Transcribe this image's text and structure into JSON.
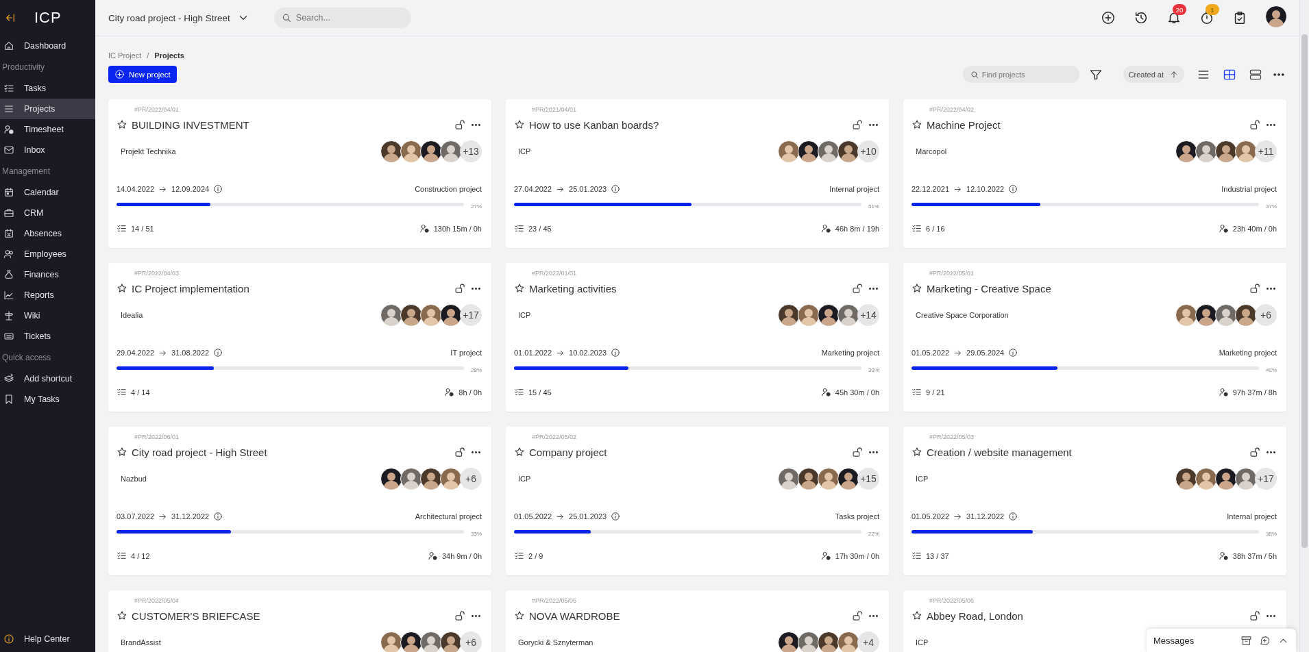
{
  "sidebar": {
    "logo": "ICP",
    "top_items": [
      {
        "label": "Dashboard",
        "selected": false
      }
    ],
    "sections": [
      {
        "title": "Productivity",
        "items": [
          {
            "label": "Tasks",
            "selected": false
          },
          {
            "label": "Projects",
            "selected": true
          },
          {
            "label": "Timesheet",
            "selected": false
          },
          {
            "label": "Inbox",
            "selected": false
          }
        ]
      },
      {
        "title": "Management",
        "items": [
          {
            "label": "Calendar",
            "selected": false
          },
          {
            "label": "CRM",
            "selected": false
          },
          {
            "label": "Absences",
            "selected": false
          },
          {
            "label": "Employees",
            "selected": false
          },
          {
            "label": "Finances",
            "selected": false
          },
          {
            "label": "Reports",
            "selected": false
          },
          {
            "label": "Wiki",
            "selected": false
          },
          {
            "label": "Tickets",
            "selected": false
          }
        ]
      },
      {
        "title": "Quick access",
        "items": [
          {
            "label": "Add shortcut",
            "selected": false
          },
          {
            "label": "My Tasks",
            "selected": false
          }
        ]
      }
    ],
    "footer_item": "Help Center"
  },
  "header": {
    "project": "City road project - High Street",
    "search_placeholder": "Search...",
    "notifications_badge": "20",
    "timer_badge": "1"
  },
  "toolbar": {
    "breadcrumb": [
      "IC Project",
      "Projects"
    ],
    "breadcrumb_separator": "/",
    "new_button": "New project",
    "find_placeholder": "Find projects",
    "sort": "Created at",
    "views": [
      {
        "selected": false
      },
      {
        "selected": true
      },
      {
        "selected": false
      }
    ]
  },
  "cards": [
    {
      "code": "#PR/2022/04/01",
      "title": "BUILDING INVESTMENT",
      "client": "Projekt Technika",
      "extra_members": "+13",
      "start": "14.04.2022",
      "end": "12.09.2024",
      "type": "Construction project",
      "level": 0.27,
      "percent": "27%",
      "tasks": "14 / 51",
      "time": "130h 15m / 0h"
    },
    {
      "code": "#PR/2021/04/01",
      "title": "How to use Kanban boards?",
      "client": "ICP",
      "extra_members": "+10",
      "start": "27.04.2022",
      "end": "25.01.2023",
      "type": "Internal project",
      "level": 0.51,
      "percent": "51%",
      "tasks": "23 / 45",
      "time": "46h 8m / 19h"
    },
    {
      "code": "#PR/2022/04/02",
      "title": "Machine Project",
      "client": "Marcopol",
      "extra_members": "+11",
      "start": "22.12.2021",
      "end": "12.10.2022",
      "type": "Industrial project",
      "level": 0.37,
      "percent": "37%",
      "tasks": "6 / 16",
      "time": "23h 40m / 0h"
    },
    {
      "code": "#PR/2022/04/03",
      "title": "IC Project implementation",
      "client": "Idealia",
      "extra_members": "+17",
      "start": "29.04.2022",
      "end": "31.08.2022",
      "type": "IT project",
      "level": 0.28,
      "percent": "28%",
      "tasks": "4 / 14",
      "time": "8h / 0h"
    },
    {
      "code": "#PR/2022/01/01",
      "title": "Marketing activities",
      "client": "ICP",
      "extra_members": "+14",
      "start": "01.01.2022",
      "end": "10.02.2023",
      "type": "Marketing project",
      "level": 0.33,
      "percent": "33%",
      "tasks": "15 / 45",
      "time": "45h 30m / 0h"
    },
    {
      "code": "#PR/2022/05/01",
      "title": "Marketing - Creative Space",
      "client": "Creative Space Corporation",
      "extra_members": "+6",
      "start": "01.05.2022",
      "end": "29.05.2024",
      "type": "Marketing project",
      "level": 0.42,
      "percent": "42%",
      "tasks": "9 / 21",
      "time": "97h 37m / 8h"
    },
    {
      "code": "#PR/2022/06/01",
      "title": "City road project - High Street",
      "client": "Nazbud",
      "extra_members": "+6",
      "start": "03.07.2022",
      "end": "31.12.2022",
      "type": "Architectural project",
      "level": 0.33,
      "percent": "33%",
      "tasks": "4 / 12",
      "time": "34h 9m / 0h"
    },
    {
      "code": "#PR/2022/05/02",
      "title": "Company project",
      "client": "ICP",
      "extra_members": "+15",
      "start": "01.05.2022",
      "end": "25.01.2023",
      "type": "Tasks project",
      "level": 0.22,
      "percent": "22%",
      "tasks": "2 / 9",
      "time": "17h 30m / 0h"
    },
    {
      "code": "#PR/2022/05/03",
      "title": "Creation / website management",
      "client": "ICP",
      "extra_members": "+17",
      "start": "01.05.2022",
      "end": "31.12.2022",
      "type": "Internal project",
      "level": 0.35,
      "percent": "35%",
      "tasks": "13 / 37",
      "time": "38h 37m / 5h"
    },
    {
      "code": "#PR/2022/05/04",
      "title": "CUSTOMER'S BRIEFCASE",
      "client": "BrandAssist",
      "extra_members": "+6"
    },
    {
      "code": "#PR/2022/05/05",
      "title": "NOVA WARDROBE",
      "client": "Gorycki & Sznyterman",
      "extra_members": "+4"
    },
    {
      "code": "#PR/2022/05/06",
      "title": "Abbey Road, London",
      "client": "ICP"
    }
  ],
  "messages": {
    "title": "Messages"
  }
}
